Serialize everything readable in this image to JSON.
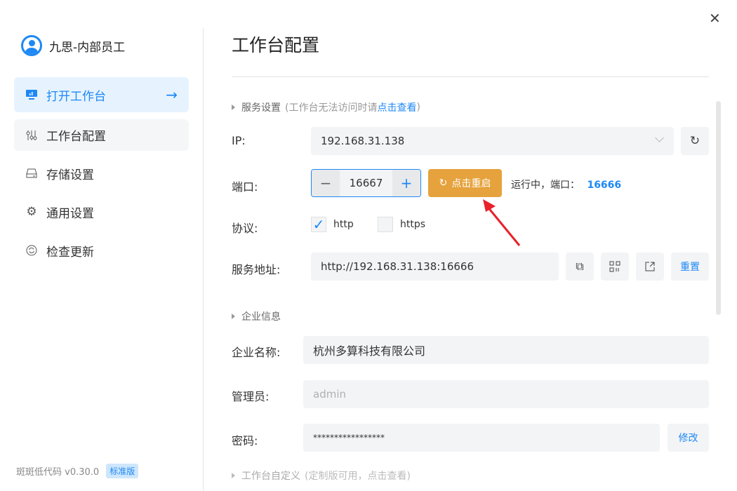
{
  "user": {
    "name": "九思-内部员工"
  },
  "sidebar": {
    "items": [
      {
        "label": "打开工作台",
        "icon": "monitor-chart-icon"
      },
      {
        "label": "工作台配置",
        "icon": "sliders-icon"
      },
      {
        "label": "存储设置",
        "icon": "hard-drive-icon"
      },
      {
        "label": "通用设置",
        "icon": "gear-icon"
      },
      {
        "label": "检查更新",
        "icon": "refresh-circle-icon"
      }
    ]
  },
  "footer": {
    "product": "斑斑低代码 v0.30.0",
    "badge": "标准版"
  },
  "main": {
    "title": "工作台配置",
    "service": {
      "section_label": "服务设置",
      "hint_prefix": "(工作台无法访问时请",
      "hint_link": "点击查看",
      "hint_suffix": ")",
      "ip_label": "IP:",
      "ip_value": "192.168.31.138",
      "port_label": "端口:",
      "port_value": "16667",
      "restart_label": "点击重启",
      "status_label": "运行中，端口：",
      "status_port": "16666",
      "protocol_label": "协议:",
      "protocols": [
        {
          "label": "http",
          "checked": true
        },
        {
          "label": "https",
          "checked": false
        }
      ],
      "address_label": "服务地址:",
      "address_value": "http://192.168.31.138:16666",
      "reset_label": "重置"
    },
    "company": {
      "section_label": "企业信息",
      "name_label": "企业名称:",
      "name_value": "杭州多算科技有限公司",
      "admin_label": "管理员:",
      "admin_placeholder": "admin",
      "password_label": "密码:",
      "password_value": "*****************",
      "modify_label": "修改"
    },
    "custom": {
      "section_label": "工作台自定义",
      "hint": "(定制版可用，点击查看)"
    }
  },
  "colors": {
    "accent": "#1e88f5",
    "restart": "#e6a23c",
    "active_bg": "#e6f3ff"
  }
}
